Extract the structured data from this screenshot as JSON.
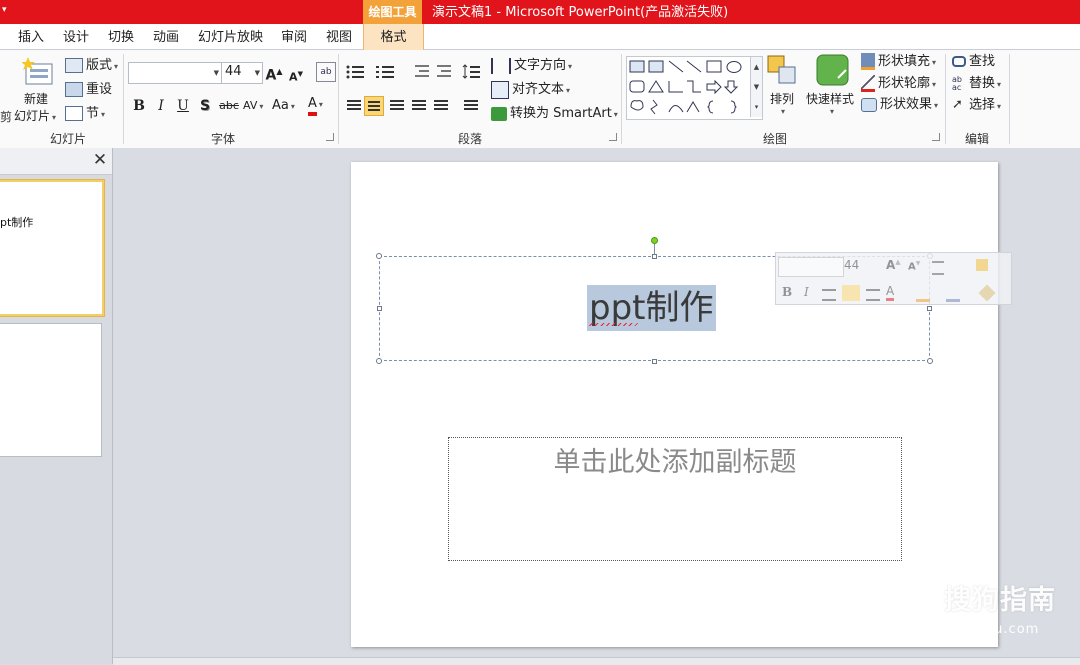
{
  "window": {
    "context_tab_group": "绘图工具",
    "title": "演示文稿1 - Microsoft PowerPoint(产品激活失败)"
  },
  "tabs": [
    "插入",
    "设计",
    "切换",
    "动画",
    "幻灯片放映",
    "审阅",
    "视图"
  ],
  "context_tab": "格式",
  "ribbon": {
    "slides": {
      "new_slide_line1": "新建",
      "new_slide_line2": "幻灯片",
      "layout": "版式",
      "reset": "重设",
      "section": "节",
      "group_label": "幻灯片",
      "cut_off_label": "剪"
    },
    "font": {
      "family_value": "",
      "size_value": "44",
      "group_label": "字体",
      "bold": "B",
      "italic": "I",
      "underline": "U",
      "shadow": "S",
      "strike": "abc",
      "spacing": "AV",
      "case": "Aa",
      "color": "A",
      "grow": "A",
      "shrink": "A"
    },
    "paragraph": {
      "text_direction": "文字方向",
      "align_text": "对齐文本",
      "convert_smartart": "转换为 SmartArt",
      "group_label": "段落"
    },
    "drawing": {
      "arrange": "排列",
      "quick_styles": "快速样式",
      "shape_fill": "形状填充",
      "shape_outline": "形状轮廓",
      "shape_effects": "形状效果",
      "group_label": "绘图"
    },
    "editing": {
      "find": "查找",
      "replace": "替换",
      "select": "选择",
      "group_label": "编辑"
    }
  },
  "thumbnails": [
    {
      "text": "pt制作"
    },
    {
      "text": ""
    }
  ],
  "slide": {
    "title_text": "ppt制作",
    "subtitle_placeholder": "单击此处添加副标题"
  },
  "mini_toolbar": {
    "size_value": "44"
  },
  "watermark": {
    "logo": "S",
    "text": "搜狗指南",
    "url": "zhinan.sogou.com"
  },
  "colors": {
    "title_bar": "#e0141a",
    "context_tab": "#f3a23a",
    "selection_highlight": "#b8c8dd",
    "active_align": "#fbd773"
  }
}
